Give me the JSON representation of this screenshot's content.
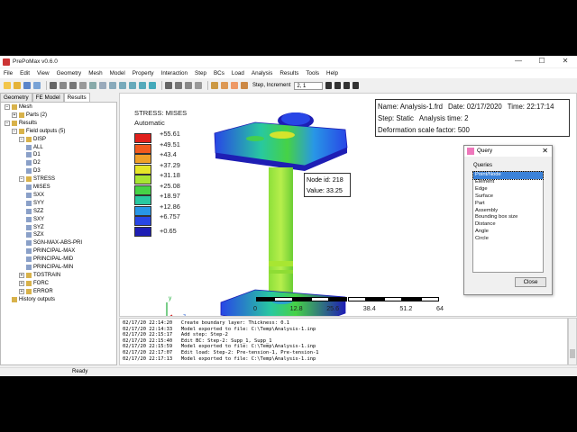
{
  "window": {
    "title": "PrePoMax v0.6.0",
    "controls": {
      "minimize": "—",
      "maximize": "☐",
      "close": "✕"
    }
  },
  "menu": [
    "File",
    "Edit",
    "View",
    "Geometry",
    "Mesh",
    "Model",
    "Property",
    "Interaction",
    "Step",
    "BCs",
    "Load",
    "Analysis",
    "Results",
    "Tools",
    "Help"
  ],
  "toolbar": {
    "step_label": "Step, Increment",
    "step_value": "2, 1"
  },
  "tabs": [
    "Geometry",
    "FE Model",
    "Results"
  ],
  "tree": {
    "items": [
      {
        "label": "Mesh",
        "level": 1,
        "expander": "−"
      },
      {
        "label": "Parts (2)",
        "level": 2,
        "expander": "+"
      },
      {
        "label": "Results",
        "level": 1,
        "expander": "−"
      },
      {
        "label": "Field outputs (5)",
        "level": 2,
        "expander": "−"
      },
      {
        "label": "DISP",
        "level": 3,
        "expander": "−"
      },
      {
        "label": "ALL",
        "level": 4,
        "expander": ""
      },
      {
        "label": "D1",
        "level": 4,
        "expander": ""
      },
      {
        "label": "D2",
        "level": 4,
        "expander": ""
      },
      {
        "label": "D3",
        "level": 4,
        "expander": ""
      },
      {
        "label": "STRESS",
        "level": 3,
        "expander": "−"
      },
      {
        "label": "MISES",
        "level": 4,
        "expander": ""
      },
      {
        "label": "SXX",
        "level": 4,
        "expander": ""
      },
      {
        "label": "SYY",
        "level": 4,
        "expander": ""
      },
      {
        "label": "SZZ",
        "level": 4,
        "expander": ""
      },
      {
        "label": "SXY",
        "level": 4,
        "expander": ""
      },
      {
        "label": "SYZ",
        "level": 4,
        "expander": ""
      },
      {
        "label": "SZX",
        "level": 4,
        "expander": ""
      },
      {
        "label": "SGN-MAX-ABS-PRI",
        "level": 4,
        "expander": ""
      },
      {
        "label": "PRINCIPAL-MAX",
        "level": 4,
        "expander": ""
      },
      {
        "label": "PRINCIPAL-MID",
        "level": 4,
        "expander": ""
      },
      {
        "label": "PRINCIPAL-MIN",
        "level": 4,
        "expander": ""
      },
      {
        "label": "TOSTRAIN",
        "level": 3,
        "expander": "+"
      },
      {
        "label": "FORC",
        "level": 3,
        "expander": "+"
      },
      {
        "label": "ERROR",
        "level": 3,
        "expander": "+"
      },
      {
        "label": "History outputs",
        "level": 2,
        "expander": ""
      }
    ]
  },
  "legend": {
    "title": "STRESS: MISES",
    "subtitle": "Automatic",
    "values": [
      "+55.61",
      "+49.51",
      "+43.4",
      "+37.29",
      "+31.18",
      "+25.08",
      "+18.97",
      "+12.86",
      "+6.757",
      "+0.65"
    ],
    "colors": [
      "#e0201c",
      "#f25a1e",
      "#f0a028",
      "#e6e628",
      "#a8e632",
      "#46d246",
      "#28c8a0",
      "#2896e6",
      "#2846e6",
      "#1e1eb4"
    ]
  },
  "info": {
    "name": "Name: Analysis-1.frd",
    "date": "Date: 02/17/2020",
    "time": "Time: 22:17:14",
    "step": "Step: Static",
    "analysis_time": "Analysis time: 2",
    "deformation": "Deformation scale factor: 500"
  },
  "probe": {
    "node": "Node id: 218",
    "value": "Value: 33.25"
  },
  "scale_bar": [
    "0",
    "12.8",
    "25.6",
    "38.4",
    "51.2",
    "64"
  ],
  "axes": {
    "y": "y",
    "x": "z"
  },
  "query_dialog": {
    "title": "Query",
    "label": "Queries",
    "items": [
      "Point/Node",
      "Element",
      "Edge",
      "Surface",
      "Part",
      "Assembly",
      "Bounding box size",
      "Distance",
      "Angle",
      "Circle"
    ],
    "selected": "Point/Node",
    "close": "Close"
  },
  "console": [
    "02/17/20 22:14:20   Create boundary layer: Thickness: 0.1",
    "02/17/20 22:14:33   Model exported to file: C:\\Temp\\Analysis-1.inp",
    "02/17/20 22:15:17   Add step: Step-2",
    "02/17/20 22:15:40   Edit BC: Step-2: Supp_1, Supp_1",
    "02/17/20 22:15:59   Model exported to file: C:\\Temp\\Analysis-1.inp",
    "02/17/20 22:17:07   Edit load: Step-2: Pre-tension-1, Pre-tension-1",
    "02/17/20 22:17:13   Model exported to file: C:\\Temp\\Analysis-1.inp"
  ],
  "status": "Ready"
}
